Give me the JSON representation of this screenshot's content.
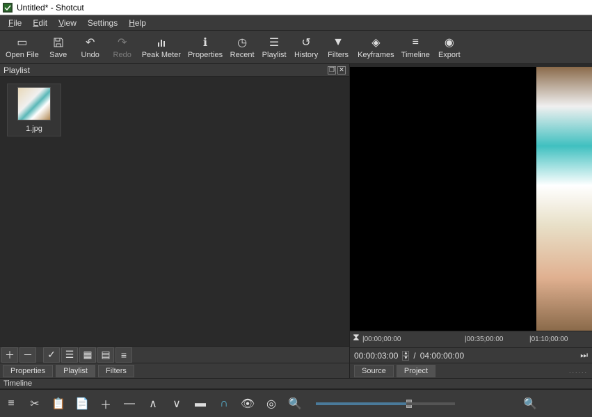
{
  "window": {
    "title": "Untitled* - Shotcut"
  },
  "menu": [
    "File",
    "Edit",
    "View",
    "Settings",
    "Help"
  ],
  "toolbar": [
    {
      "icon": "open",
      "label": "Open File"
    },
    {
      "icon": "save",
      "label": "Save"
    },
    {
      "icon": "undo",
      "label": "Undo"
    },
    {
      "icon": "redo",
      "label": "Redo",
      "disabled": true
    },
    {
      "icon": "meter",
      "label": "Peak Meter"
    },
    {
      "icon": "info",
      "label": "Properties"
    },
    {
      "icon": "recent",
      "label": "Recent"
    },
    {
      "icon": "list",
      "label": "Playlist"
    },
    {
      "icon": "history",
      "label": "History"
    },
    {
      "icon": "filters",
      "label": "Filters"
    },
    {
      "icon": "keyframes",
      "label": "Keyframes"
    },
    {
      "icon": "timeline",
      "label": "Timeline"
    },
    {
      "icon": "export",
      "label": "Export"
    }
  ],
  "playlist": {
    "title": "Playlist",
    "items": [
      {
        "name": "1.jpg"
      }
    ]
  },
  "playlist_toolbar_icons": [
    "add",
    "remove",
    "sep",
    "check",
    "list",
    "grid",
    "detail",
    "menu"
  ],
  "left_tabs": [
    "Properties",
    "Playlist",
    "Filters"
  ],
  "left_active_tab": 1,
  "ruler": {
    "marks": [
      "00:00;00:00",
      "00:35;00:00",
      "01:10;00:00"
    ],
    "playhead_icon": "playhead"
  },
  "time": {
    "current": "00:00:03:00",
    "total": "04:00:00:00"
  },
  "preview_tabs": [
    "Source",
    "Project"
  ],
  "preview_active_tab": 1,
  "ellipsis": "......",
  "timeline": {
    "title": "Timeline"
  },
  "timeline_toolbar": [
    "menu",
    "cut",
    "copy",
    "paste",
    "plus",
    "minus",
    "up",
    "down",
    "overwrite",
    "snap",
    "show",
    "scrub",
    "zoom-out",
    "slider",
    "zoom-in"
  ]
}
